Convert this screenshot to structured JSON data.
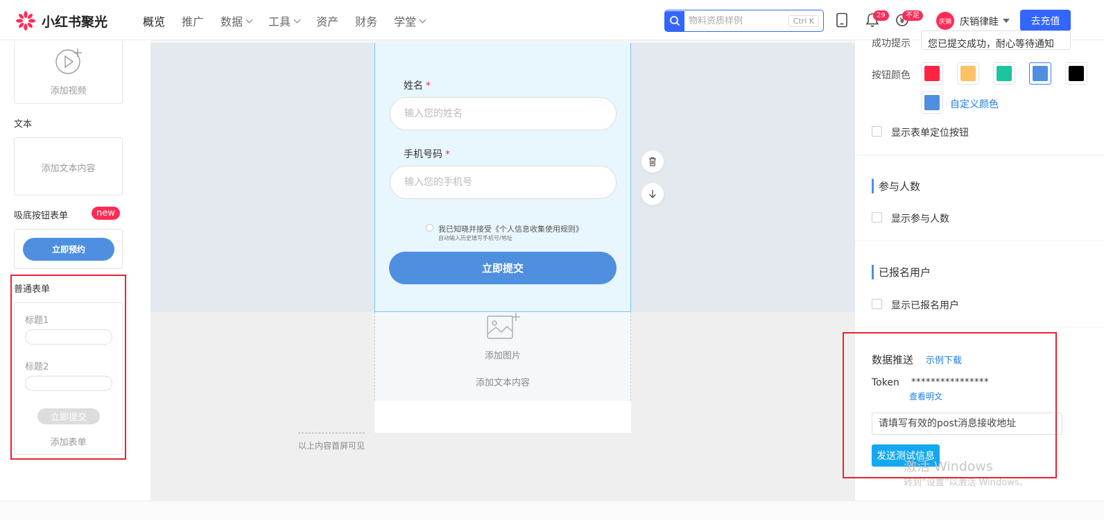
{
  "app": {
    "name": "小红书聚光"
  },
  "nav": {
    "items": [
      {
        "label": "概览"
      },
      {
        "label": "推广"
      },
      {
        "label": "数据"
      },
      {
        "label": "工具"
      },
      {
        "label": "资产"
      },
      {
        "label": "财务"
      },
      {
        "label": "学堂"
      }
    ],
    "active_index": 0,
    "dropdown_indices": [
      2,
      3,
      6
    ]
  },
  "header": {
    "search_placeholder": "物料资质样例",
    "search_shortcut": "Ctrl K",
    "notification_count": "29",
    "balance_badge": "不足",
    "avatar_text": "庆销",
    "username": "庆销律眭",
    "recharge_label": "去充值"
  },
  "left": {
    "add_video": "添加视频",
    "text_section": "文本",
    "add_text": "添加文本内容",
    "sticky_form_label": "吸底按钮表单",
    "new_badge": "new",
    "book_now": "立即预约",
    "normal_form_label": "普通表单",
    "title1": "标题1",
    "title2": "标题2",
    "mini_submit": "立即提交",
    "add_form": "添加表单"
  },
  "canvas": {
    "name_label": "姓名",
    "name_placeholder": "输入您的姓名",
    "phone_label": "手机号码",
    "phone_placeholder": "输入您的手机号",
    "required_mark": "*",
    "consent": "我已知晓并接受《个人信息收集使用规则》",
    "consent_sub": "自动输入历史填写手机号/地址",
    "submit": "立即提交",
    "add_image": "添加图片",
    "add_text": "添加文本内容",
    "fold_hint": "以上内容首屏可见"
  },
  "right": {
    "success_label": "成功提示",
    "success_value": "您已提交成功，耐心等待通知",
    "button_color_label": "按钮颜色",
    "swatches": [
      {
        "color": "#ff2442",
        "selected": false
      },
      {
        "color": "#ffc166",
        "selected": false
      },
      {
        "color": "#1cc4a0",
        "selected": false
      },
      {
        "color": "#4f8fe0",
        "selected": true
      },
      {
        "color": "#000000",
        "selected": false
      }
    ],
    "custom_color_value": "#4f8fe0",
    "custom_color_label": "自定义颜色",
    "show_locate_btn": "显示表单定位按钮",
    "participants_title": "参与人数",
    "show_participants": "显示参与人数",
    "registered_title": "已报名用户",
    "show_registered": "显示已报名用户",
    "data_push_title": "数据推送",
    "example_download": "示例下载",
    "token_label": "Token",
    "token_value": "****************",
    "view_plain": "查看明文",
    "post_placeholder": "请填写有效的post消息接收地址",
    "send_test": "发送测试信息"
  },
  "watermark": {
    "line1": "激活 Windows",
    "line2": "转到“设置”以激活 Windows。"
  }
}
